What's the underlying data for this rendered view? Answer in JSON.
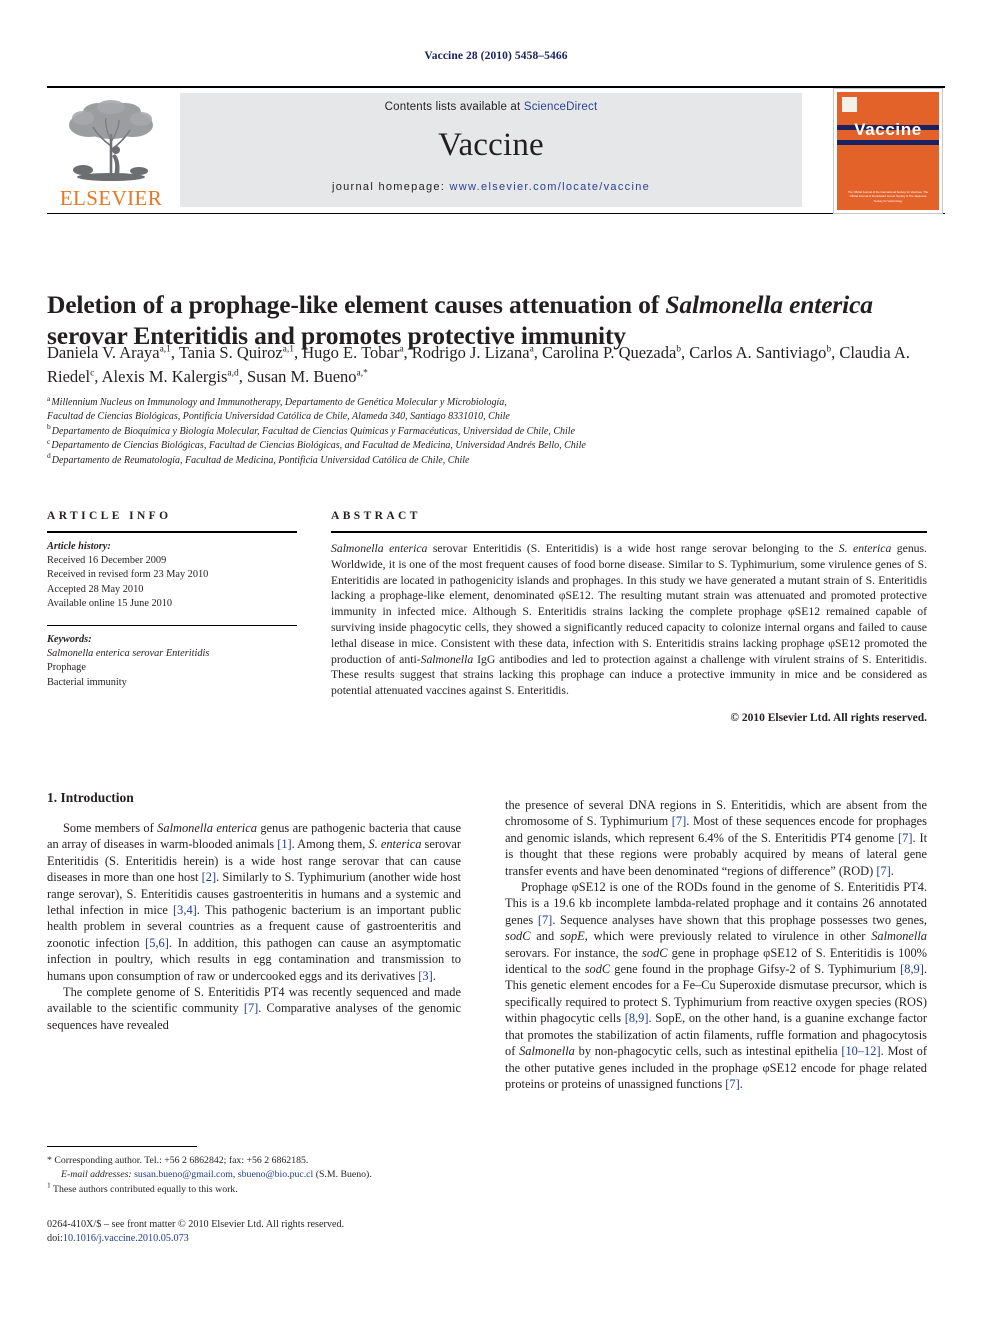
{
  "running_head": "Vaccine 28 (2010) 5458–5466",
  "masthead": {
    "contents_prefix": "Contents lists available at ",
    "sciencedirect": "ScienceDirect",
    "journal_title": "Vaccine",
    "homepage_prefix": "journal homepage: ",
    "homepage_url": "www.elsevier.com/locate/vaccine",
    "publisher": "ELSEVIER",
    "cover": {
      "title": "Vaccine",
      "footer": "The Official Journal of the International Society for Vaccines. The Official Journal of the Edward Jenner Society & The Japanese Society for Vaccinology"
    }
  },
  "colors": {
    "elsevier_orange": "#e87722",
    "link_blue": "#2b3f94",
    "reference_blue": "#1f3b8f",
    "cover_orange": "#e2622a",
    "cover_navy": "#1a2160",
    "band_gray": "#e6e7e8"
  },
  "article": {
    "title_part1": "Deletion of a prophage-like element causes attenuation of ",
    "title_italic": "Salmonella enterica",
    "title_part2": " serovar Enteritidis and promotes protective immunity",
    "authors": [
      {
        "name": "Daniela V. Araya",
        "sup": "a,1",
        "sep": ", "
      },
      {
        "name": "Tania S. Quiroz",
        "sup": "a,1",
        "sep": ", "
      },
      {
        "name": "Hugo E. Tobar",
        "sup": "a",
        "sep": ", "
      },
      {
        "name": "Rodrigo J. Lizana",
        "sup": "a",
        "sep": ", "
      },
      {
        "name": "Carolina P. Quezada",
        "sup": "b",
        "sep": ", "
      },
      {
        "name": "Carlos A. Santiviago",
        "sup": "b",
        "sep": ", "
      },
      {
        "name": "Claudia A. Riedel",
        "sup": "c",
        "sep": ", "
      },
      {
        "name": "Alexis M. Kalergis",
        "sup": "a,d",
        "sep": ", "
      },
      {
        "name": "Susan M. Bueno",
        "sup": "a,*",
        "sep": ""
      }
    ],
    "affiliations": [
      {
        "mark": "a",
        "text": "Millennium Nucleus on Immunology and Immunotherapy, Departamento de Genética Molecular y Microbiología,"
      },
      {
        "mark": "",
        "text": "Facultad de Ciencias Biológicas, Pontificia Universidad Católica de Chile, Alameda 340, Santiago 8331010, Chile"
      },
      {
        "mark": "b",
        "text": "Departamento de Bioquímica y Biología Molecular, Facultad de Ciencias Químicas y Farmacéuticas, Universidad de Chile, Chile"
      },
      {
        "mark": "c",
        "text": "Departamento de Ciencias Biológicas, Facultad de Ciencias Biológicas, and Facultad de Medicina, Universidad Andrés Bello, Chile"
      },
      {
        "mark": "d",
        "text": "Departamento de Reumatología, Facultad de Medicina, Pontificia Universidad Católica de Chile, Chile"
      }
    ]
  },
  "article_info": {
    "label": "ARTICLE INFO",
    "history_label": "Article history:",
    "history": [
      "Received 16 December 2009",
      "Received in revised form 23 May 2010",
      "Accepted 28 May 2010",
      "Available online 15 June 2010"
    ],
    "keywords_label": "Keywords:",
    "keywords": [
      "Salmonella enterica serovar Enteritidis",
      "Prophage",
      "Bacterial immunity"
    ]
  },
  "abstract": {
    "label": "ABSTRACT",
    "text": "Salmonella enterica serovar Enteritidis (S. Enteritidis) is a wide host range serovar belonging to the S. enterica genus. Worldwide, it is one of the most frequent causes of food borne disease. Similar to S. Typhimurium, some virulence genes of S. Enteritidis are located in pathogenicity islands and prophages. In this study we have generated a mutant strain of S. Enteritidis lacking a prophage-like element, denominated φSE12. The resulting mutant strain was attenuated and promoted protective immunity in infected mice. Although S. Enteritidis strains lacking the complete prophage φSE12 remained capable of surviving inside phagocytic cells, they showed a significantly reduced capacity to colonize internal organs and failed to cause lethal disease in mice. Consistent with these data, infection with S. Enteritidis strains lacking prophage φSE12 promoted the production of anti-Salmonella IgG antibodies and led to protection against a challenge with virulent strains of S. Enteritidis. These results suggest that strains lacking this prophage can induce a protective immunity in mice and be considered as potential attenuated vaccines against S. Enteritidis.",
    "copyright": "© 2010 Elsevier Ltd. All rights reserved."
  },
  "body": {
    "section_heading": "1. Introduction",
    "left_paragraph_1": "Some members of Salmonella enterica genus are pathogenic bacteria that cause an array of diseases in warm-blooded animals [1]. Among them, S. enterica serovar Enteritidis (S. Enteritidis herein) is a wide host range serovar that can cause diseases in more than one host [2]. Similarly to S. Typhimurium (another wide host range serovar), S. Enteritidis causes gastroenteritis in humans and a systemic and lethal infection in mice [3,4]. This pathogenic bacterium is an important public health problem in several countries as a frequent cause of gastroenteritis and zoonotic infection [5,6]. In addition, this pathogen can cause an asymptomatic infection in poultry, which results in egg contamination and transmission to humans upon consumption of raw or undercooked eggs and its derivatives [3].",
    "left_paragraph_2": "The complete genome of S. Enteritidis PT4 was recently sequenced and made available to the scientific community [7]. Comparative analyses of the genomic sequences have revealed",
    "right_paragraph_1": "the presence of several DNA regions in S. Enteritidis, which are absent from the chromosome of S. Typhimurium [7]. Most of these sequences encode for prophages and genomic islands, which represent 6.4% of the S. Enteritidis PT4 genome [7]. It is thought that these regions were probably acquired by means of lateral gene transfer events and have been denominated “regions of difference” (ROD) [7].",
    "right_paragraph_2": "Prophage φSE12 is one of the RODs found in the genome of S. Enteritidis PT4. This is a 19.6 kb incomplete lambda-related prophage and it contains 26 annotated genes [7]. Sequence analyses have shown that this prophage possesses two genes, sodC and sopE, which were previously related to virulence in other Salmonella serovars. For instance, the sodC gene in prophage φSE12 of S. Enteritidis is 100% identical to the sodC gene found in the prophage Gifsy-2 of S. Typhimurium [8,9]. This genetic element encodes for a Fe–Cu Superoxide dismutase precursor, which is specifically required to protect S. Typhimurium from reactive oxygen species (ROS) within phagocytic cells [8,9]. SopE, on the other hand, is a guanine exchange factor that promotes the stabilization of actin filaments, ruffle formation and phagocytosis of Salmonella by non-phagocytic cells, such as intestinal epithelia [10–12]. Most of the other putative genes included in the prophage φSE12 encode for phage related proteins or proteins of unassigned functions [7]."
  },
  "footnotes": {
    "corresponding": "Corresponding author. Tel.: +56 2 6862842; fax: +56 2 6862185.",
    "email_label": "E-mail addresses:",
    "email1": "susan.bueno@gmail.com",
    "email2": "sbueno@bio.puc.cl",
    "email_suffix": "(S.M. Bueno).",
    "equal_contribution": "These authors contributed equally to this work.",
    "issn_line": "0264-410X/$ – see front matter © 2010 Elsevier Ltd. All rights reserved.",
    "doi_label": "doi:",
    "doi_value": "10.1016/j.vaccine.2010.05.073"
  }
}
